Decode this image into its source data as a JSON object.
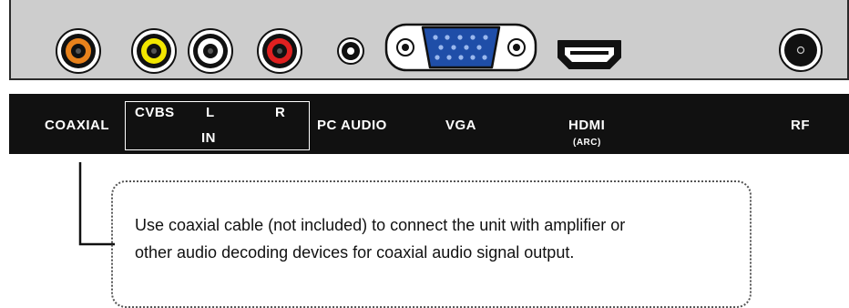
{
  "ports": {
    "coaxial": "coaxial-jack-icon",
    "cvbs": "cvbs-yellow-jack-icon",
    "audio_l": "audio-left-white-jack-icon",
    "audio_r": "audio-right-red-jack-icon",
    "pc_audio": "pc-audio-minijack-icon",
    "vga": "vga-d-sub-icon",
    "hdmi": "hdmi-port-icon",
    "rf": "rf-antenna-jack-icon"
  },
  "colors": {
    "panel": "#cdcdcd",
    "label_bar": "#111111",
    "coaxial_ring": "#e8821c",
    "cvbs_ring": "#f2e600",
    "audio_l_ring": "#ffffff",
    "audio_r_ring": "#e02020",
    "vga_body": "#1f4ea8"
  },
  "labels": {
    "coaxial": "COAXIAL",
    "cvbs": "CVBS",
    "l": "L",
    "r": "R",
    "in": "IN",
    "pc_audio": "PC AUDIO",
    "vga": "VGA",
    "hdmi": "HDMI",
    "arc": "(ARC)",
    "rf": "RF"
  },
  "callout": {
    "line1": "Use coaxial cable (not included) to connect the unit with amplifier or",
    "line2": "other audio decoding devices for coaxial audio signal output."
  }
}
